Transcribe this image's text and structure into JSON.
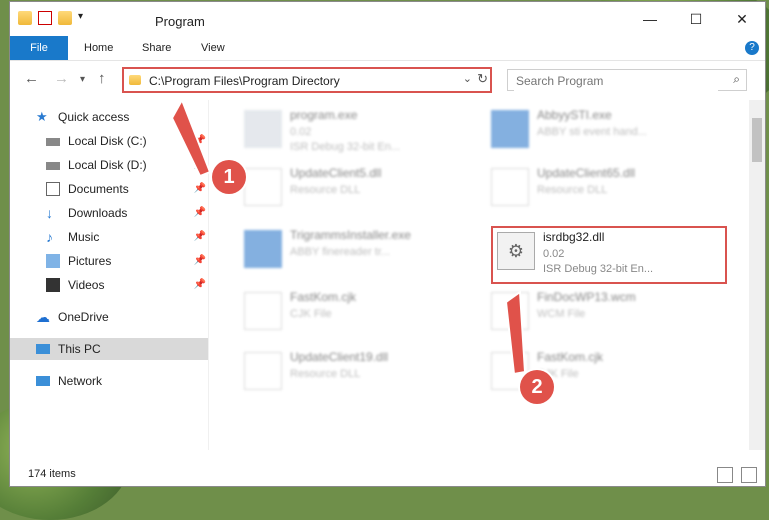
{
  "window": {
    "title": "Program",
    "controls": {
      "minimize": "—",
      "maximize": "☐",
      "close": "✕"
    }
  },
  "ribbon": {
    "tabs": [
      "File",
      "Home",
      "Share",
      "View"
    ],
    "help": "?"
  },
  "address": {
    "path": "C:\\Program Files\\Program Directory",
    "search_placeholder": "Search Program"
  },
  "nav": {
    "items": [
      {
        "label": "Quick access",
        "icon": "star-icon"
      },
      {
        "label": "Local Disk (C:)",
        "icon": "drive-icon",
        "pinned": true
      },
      {
        "label": "Local Disk (D:)",
        "icon": "drive-icon",
        "pinned": true
      },
      {
        "label": "Documents",
        "icon": "documents-icon",
        "pinned": true
      },
      {
        "label": "Downloads",
        "icon": "download-icon",
        "pinned": true
      },
      {
        "label": "Music",
        "icon": "music-icon",
        "pinned": true
      },
      {
        "label": "Pictures",
        "icon": "pictures-icon",
        "pinned": true
      },
      {
        "label": "Videos",
        "icon": "videos-icon",
        "pinned": true
      },
      {
        "label": "OneDrive",
        "icon": "cloud-icon"
      },
      {
        "label": "This PC",
        "icon": "computer-icon",
        "selected": true
      },
      {
        "label": "Network",
        "icon": "network-icon"
      }
    ]
  },
  "files": [
    {
      "name": "program.exe",
      "l2": "0.02",
      "l3": "ISR Debug 32-bit En..."
    },
    {
      "name": "AbbyySTI.exe",
      "l2": "ABBY sti event hand..."
    },
    {
      "name": "UpdateClient5.dll",
      "l2": "Resource DLL"
    },
    {
      "name": "UpdateClient65.dll",
      "l2": "Resource DLL"
    },
    {
      "name": "TrigrammsInstaller.exe",
      "l2": "ABBY finereader tr..."
    },
    {
      "name": "isrdbg32.dll",
      "l2": "0.02",
      "l3": "ISR Debug 32-bit En..."
    },
    {
      "name": "FastKom.cjk",
      "l2": "CJK File"
    },
    {
      "name": "FinDocWP13.wcm",
      "l2": "WCM File"
    },
    {
      "name": "UpdateClient19.dll",
      "l2": "Resource DLL"
    },
    {
      "name": "FastKom.cjk",
      "l2": "CJK File"
    }
  ],
  "status": {
    "items": "174 items"
  },
  "annotations": {
    "step1": "1",
    "step2": "2"
  },
  "colors": {
    "accent": "#1979ca",
    "highlight": "#d9534f"
  }
}
